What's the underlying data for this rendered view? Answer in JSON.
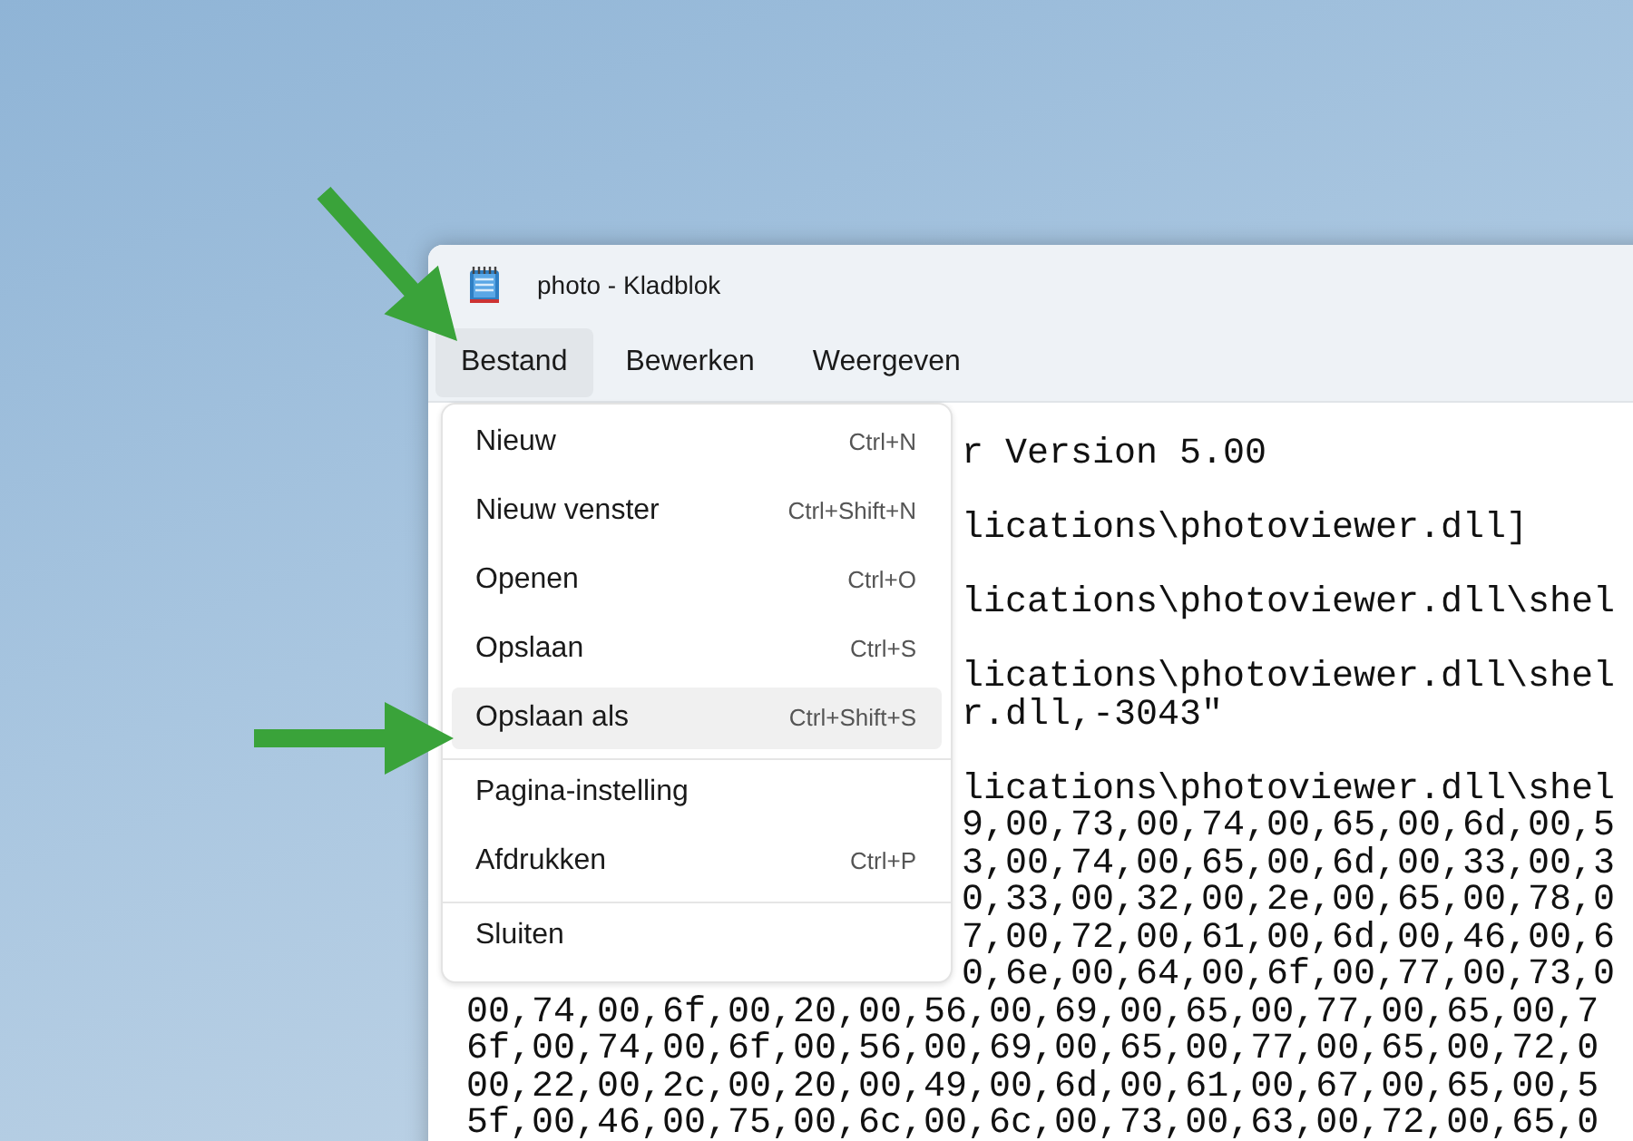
{
  "window": {
    "title": "photo - Kladblok"
  },
  "menubar": [
    {
      "label": "Bestand",
      "selected": true
    },
    {
      "label": "Bewerken",
      "selected": false
    },
    {
      "label": "Weergeven",
      "selected": false
    }
  ],
  "file_menu": [
    {
      "kind": "item",
      "label": "Nieuw",
      "shortcut": "Ctrl+N",
      "selected": false
    },
    {
      "kind": "item",
      "label": "Nieuw venster",
      "shortcut": "Ctrl+Shift+N",
      "selected": false
    },
    {
      "kind": "item",
      "label": "Openen",
      "shortcut": "Ctrl+O",
      "selected": false
    },
    {
      "kind": "item",
      "label": "Opslaan",
      "shortcut": "Ctrl+S",
      "selected": false
    },
    {
      "kind": "item",
      "label": "Opslaan als",
      "shortcut": "Ctrl+Shift+S",
      "selected": true
    },
    {
      "kind": "separator"
    },
    {
      "kind": "item",
      "label": "Pagina-instelling",
      "selected": false
    },
    {
      "kind": "item",
      "label": "Afdrukken",
      "shortcut": "Ctrl+P",
      "selected": false
    },
    {
      "kind": "separator"
    },
    {
      "kind": "item",
      "label": "Sluiten",
      "selected": false
    }
  ],
  "editor_lines": [
    {
      "kind": "covered",
      "text": "r Version 5.00"
    },
    {
      "kind": "blank"
    },
    {
      "kind": "covered",
      "text": "lications\\photoviewer.dll]"
    },
    {
      "kind": "blank"
    },
    {
      "kind": "covered",
      "text": "lications\\photoviewer.dll\\shel"
    },
    {
      "kind": "blank"
    },
    {
      "kind": "covered",
      "text": "lications\\photoviewer.dll\\shel"
    },
    {
      "kind": "covered",
      "text": "r.dll,-3043\""
    },
    {
      "kind": "blank"
    },
    {
      "kind": "covered",
      "text": "lications\\photoviewer.dll\\shel"
    },
    {
      "kind": "covered",
      "text": "9,00,73,00,74,00,65,00,6d,00,5"
    },
    {
      "kind": "covered",
      "text": "3,00,74,00,65,00,6d,00,33,00,3"
    },
    {
      "kind": "covered",
      "text": "0,33,00,32,00,2e,00,65,00,78,0"
    },
    {
      "kind": "covered",
      "text": "7,00,72,00,61,00,6d,00,46,00,6"
    },
    {
      "kind": "covered",
      "text": "0,6e,00,64,00,6f,00,77,00,73,0"
    },
    {
      "kind": "full",
      "text": "00,74,00,6f,00,20,00,56,00,69,00,65,00,77,00,65,00,7"
    },
    {
      "kind": "full",
      "text": "6f,00,74,00,6f,00,56,00,69,00,65,00,77,00,65,00,72,0"
    },
    {
      "kind": "full",
      "text": "00,22,00,2c,00,20,00,49,00,6d,00,61,00,67,00,65,00,5"
    },
    {
      "kind": "full",
      "text": "5f,00,46,00,75,00,6c,00,6c,00,73,00,63,00,72,00,65,0"
    }
  ]
}
